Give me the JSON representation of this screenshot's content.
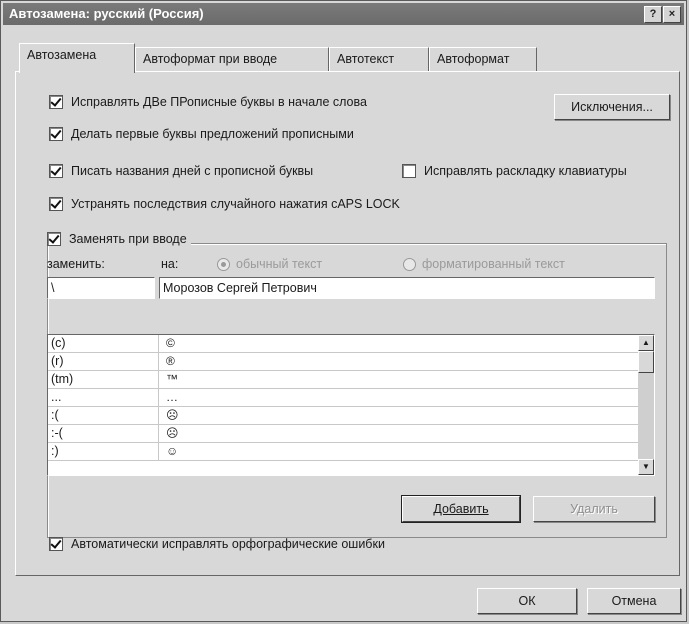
{
  "window": {
    "title": "Автозамена: русский (Россия)",
    "help_glyph": "?",
    "close_glyph": "×"
  },
  "tabs": [
    {
      "label": "Автозамена"
    },
    {
      "label": "Автоформат при вводе"
    },
    {
      "label": "Автотекст"
    },
    {
      "label": "Автоформат"
    }
  ],
  "options": {
    "two_caps": "Исправлять ДВе ПРописные буквы в начале слова",
    "first_letter": "Делать первые буквы предложений прописными",
    "day_names": "Писать названия дней с прописной буквы",
    "keyboard_layout": "Исправлять раскладку клавиатуры",
    "caps_lock": "Устранять последствия случайного нажатия cAPS LOCK",
    "replace_as_type": "Заменять при вводе"
  },
  "exceptions_button": "Исключения...",
  "replace": {
    "replace_label": "заменить:",
    "with_label": "на:",
    "plain_text": "обычный текст",
    "formatted_text": "форматированный текст",
    "replace_value": "\\",
    "with_value": "Морозов Сергей Петрович"
  },
  "list": [
    {
      "from": "(c)",
      "to": "©"
    },
    {
      "from": "(r)",
      "to": "®"
    },
    {
      "from": "(tm)",
      "to": "™"
    },
    {
      "from": "...",
      "to": "…"
    },
    {
      "from": ":(",
      "to": "☹"
    },
    {
      "from": ":-(",
      "to": "☹"
    },
    {
      "from": ":)",
      "to": "☺"
    }
  ],
  "add_button": "Добавить",
  "delete_button": "Удалить",
  "spell_option": "Автоматически исправлять орфографические ошибки",
  "ok_button": "ОК",
  "cancel_button": "Отмена"
}
